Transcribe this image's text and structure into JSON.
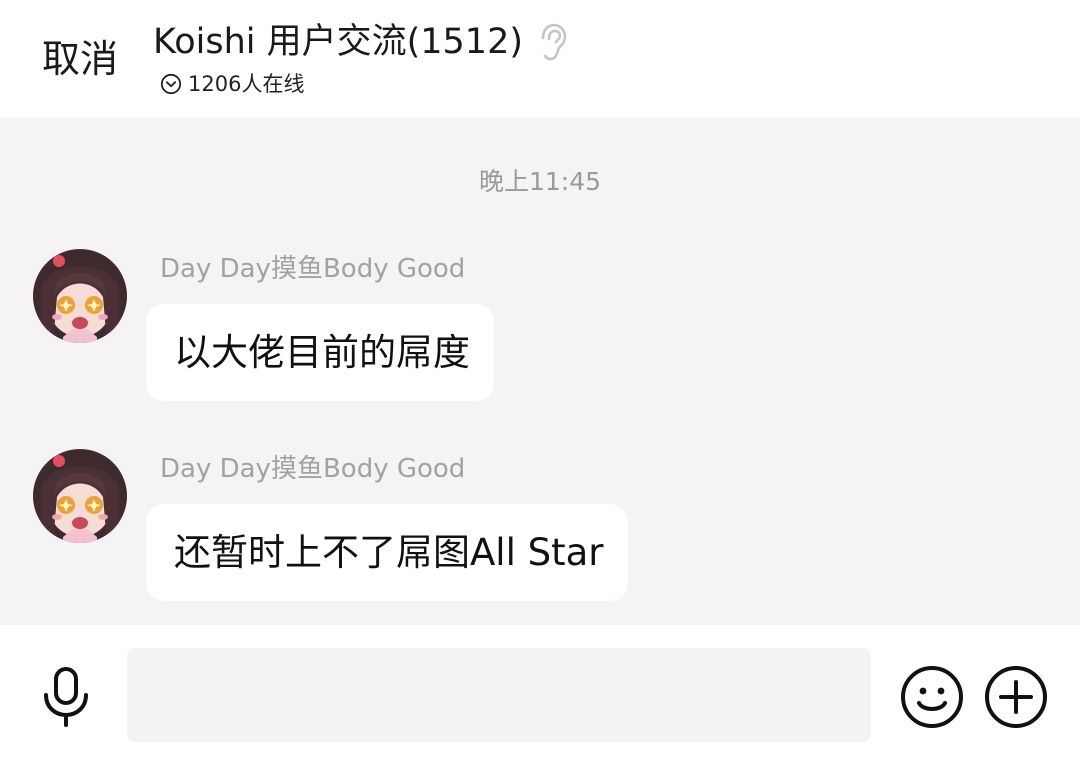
{
  "header": {
    "cancel_label": "取消",
    "title": "Koishi 用户交流(1512)",
    "online_text": "1206人在线",
    "ear_icon": "ear-icon",
    "chevron_icon": "chevron-down-circle-icon"
  },
  "chat": {
    "timestamp": "晚上11:45",
    "messages": [
      {
        "sender": "Day Day摸鱼Body Good",
        "text": "以大佬目前的屌度",
        "avatar": "anime-girl-avatar"
      },
      {
        "sender": "Day Day摸鱼Body Good",
        "text": "还暂时上不了屌图All Star",
        "avatar": "anime-girl-avatar"
      }
    ]
  },
  "input_bar": {
    "placeholder": "",
    "voice_icon": "microphone-icon",
    "emoji_icon": "smiley-icon",
    "more_icon": "plus-circle-icon"
  },
  "colors": {
    "chat_background": "#f5f3f5",
    "bubble_background": "#ffffff",
    "secondary_text": "#a2a2a2"
  }
}
